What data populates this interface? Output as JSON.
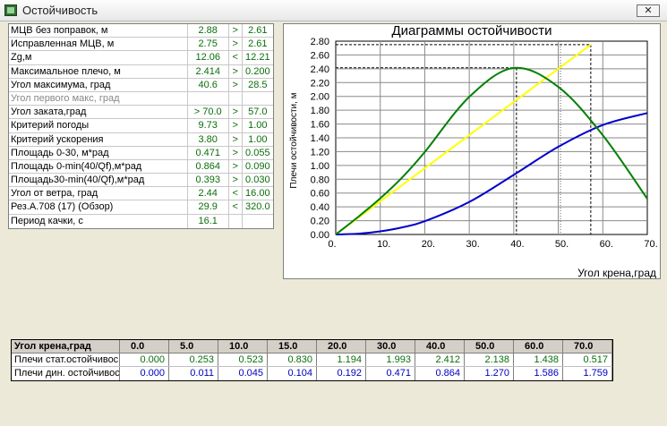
{
  "window": {
    "title": "Остойчивость",
    "close_glyph": "✕"
  },
  "params": [
    {
      "name": "МЦВ без поправок, м",
      "value": "2.88",
      "cmp": ">",
      "criterion": "2.61"
    },
    {
      "name": "Исправленная МЦВ, м",
      "value": "2.75",
      "cmp": ">",
      "criterion": "2.61"
    },
    {
      "name": "Zg,м",
      "value": "12.06",
      "cmp": "<",
      "criterion": "12.21"
    },
    {
      "name": "Максимальное плечо, м",
      "value": "2.414",
      "cmp": ">",
      "criterion": "0.200"
    },
    {
      "name": "Угол максимума, град",
      "value": "40.6",
      "cmp": ">",
      "criterion": "28.5"
    },
    {
      "name": "Угол первого макс, град",
      "value": "",
      "cmp": "",
      "criterion": "",
      "disabled": true
    },
    {
      "name": "Угол заката,град",
      "value": "> 70.0",
      "cmp": ">",
      "criterion": "57.0"
    },
    {
      "name": "Критерий погоды",
      "value": "9.73",
      "cmp": ">",
      "criterion": "1.00"
    },
    {
      "name": "Критерий ускорения",
      "value": "3.80",
      "cmp": ">",
      "criterion": "1.00"
    },
    {
      "name": "Площадь 0-30, м*рад",
      "value": "0.471",
      "cmp": ">",
      "criterion": "0.055"
    },
    {
      "name": "Площадь 0-min(40/Qf),м*рад",
      "value": "0.864",
      "cmp": ">",
      "criterion": "0.090"
    },
    {
      "name": "Площадь30-min(40/Qf),м*рад",
      "value": "0.393",
      "cmp": ">",
      "criterion": "0.030"
    },
    {
      "name": "Угол от ветра, град",
      "value": "2.44",
      "cmp": "<",
      "criterion": "16.00"
    },
    {
      "name": "Рез.А.708 (17) (Обзор)",
      "value": "29.9",
      "cmp": "<",
      "criterion": "320.0"
    },
    {
      "name": "Период качки, с",
      "value": "16.1",
      "cmp": "",
      "criterion": ""
    }
  ],
  "chart_data": {
    "type": "line",
    "title": "Диаграммы остойчивости",
    "xlabel": "Угол крена,град",
    "ylabel": "Плечи остойчивости, м",
    "xlim": [
      0,
      70
    ],
    "ylim": [
      0,
      2.8
    ],
    "x_ticks": [
      "0.",
      "10.",
      "20.",
      "30.",
      "40.",
      "50.",
      "60.",
      "70."
    ],
    "y_ticks": [
      "0.00",
      "0.20",
      "0.40",
      "0.60",
      "0.80",
      "1.00",
      "1.20",
      "1.40",
      "1.60",
      "1.80",
      "2.00",
      "2.20",
      "2.40",
      "2.60",
      "2.80"
    ],
    "grid": true,
    "x": [
      0,
      5,
      10,
      15,
      20,
      30,
      40,
      50,
      60,
      70
    ],
    "series": [
      {
        "name": "Плечи стат.остойчивости",
        "color": "#008000",
        "values": [
          0.0,
          0.253,
          0.523,
          0.83,
          1.194,
          1.993,
          2.412,
          2.138,
          1.438,
          0.517
        ]
      },
      {
        "name": "Плечи дин. остойчивости",
        "color": "#0000cc",
        "values": [
          0.0,
          0.011,
          0.045,
          0.104,
          0.192,
          0.471,
          0.864,
          1.27,
          1.586,
          1.759
        ]
      }
    ],
    "tangent_line": {
      "color": "#ffff00",
      "x": [
        0,
        57.3
      ],
      "y": [
        0,
        2.75
      ]
    },
    "reference_lines": [
      {
        "style": "dashed",
        "x": 40.6,
        "y": 2.414
      },
      {
        "style": "dashed",
        "x": 57.3,
        "y": 2.75
      },
      {
        "style": "dotted",
        "x": 50.5
      }
    ]
  },
  "angle_table": {
    "header_label": "Угол крена,град",
    "angles": [
      "0.0",
      "5.0",
      "10.0",
      "15.0",
      "20.0",
      "30.0",
      "40.0",
      "50.0",
      "60.0",
      "70.0"
    ],
    "rows": [
      {
        "label": "Плечи стат.остойчивос",
        "color": "green",
        "values": [
          "0.000",
          "0.253",
          "0.523",
          "0.830",
          "1.194",
          "1.993",
          "2.412",
          "2.138",
          "1.438",
          "0.517"
        ]
      },
      {
        "label": "Плечи дин. остойчивос",
        "color": "blue",
        "values": [
          "0.000",
          "0.011",
          "0.045",
          "0.104",
          "0.192",
          "0.471",
          "0.864",
          "1.270",
          "1.586",
          "1.759"
        ]
      }
    ]
  }
}
